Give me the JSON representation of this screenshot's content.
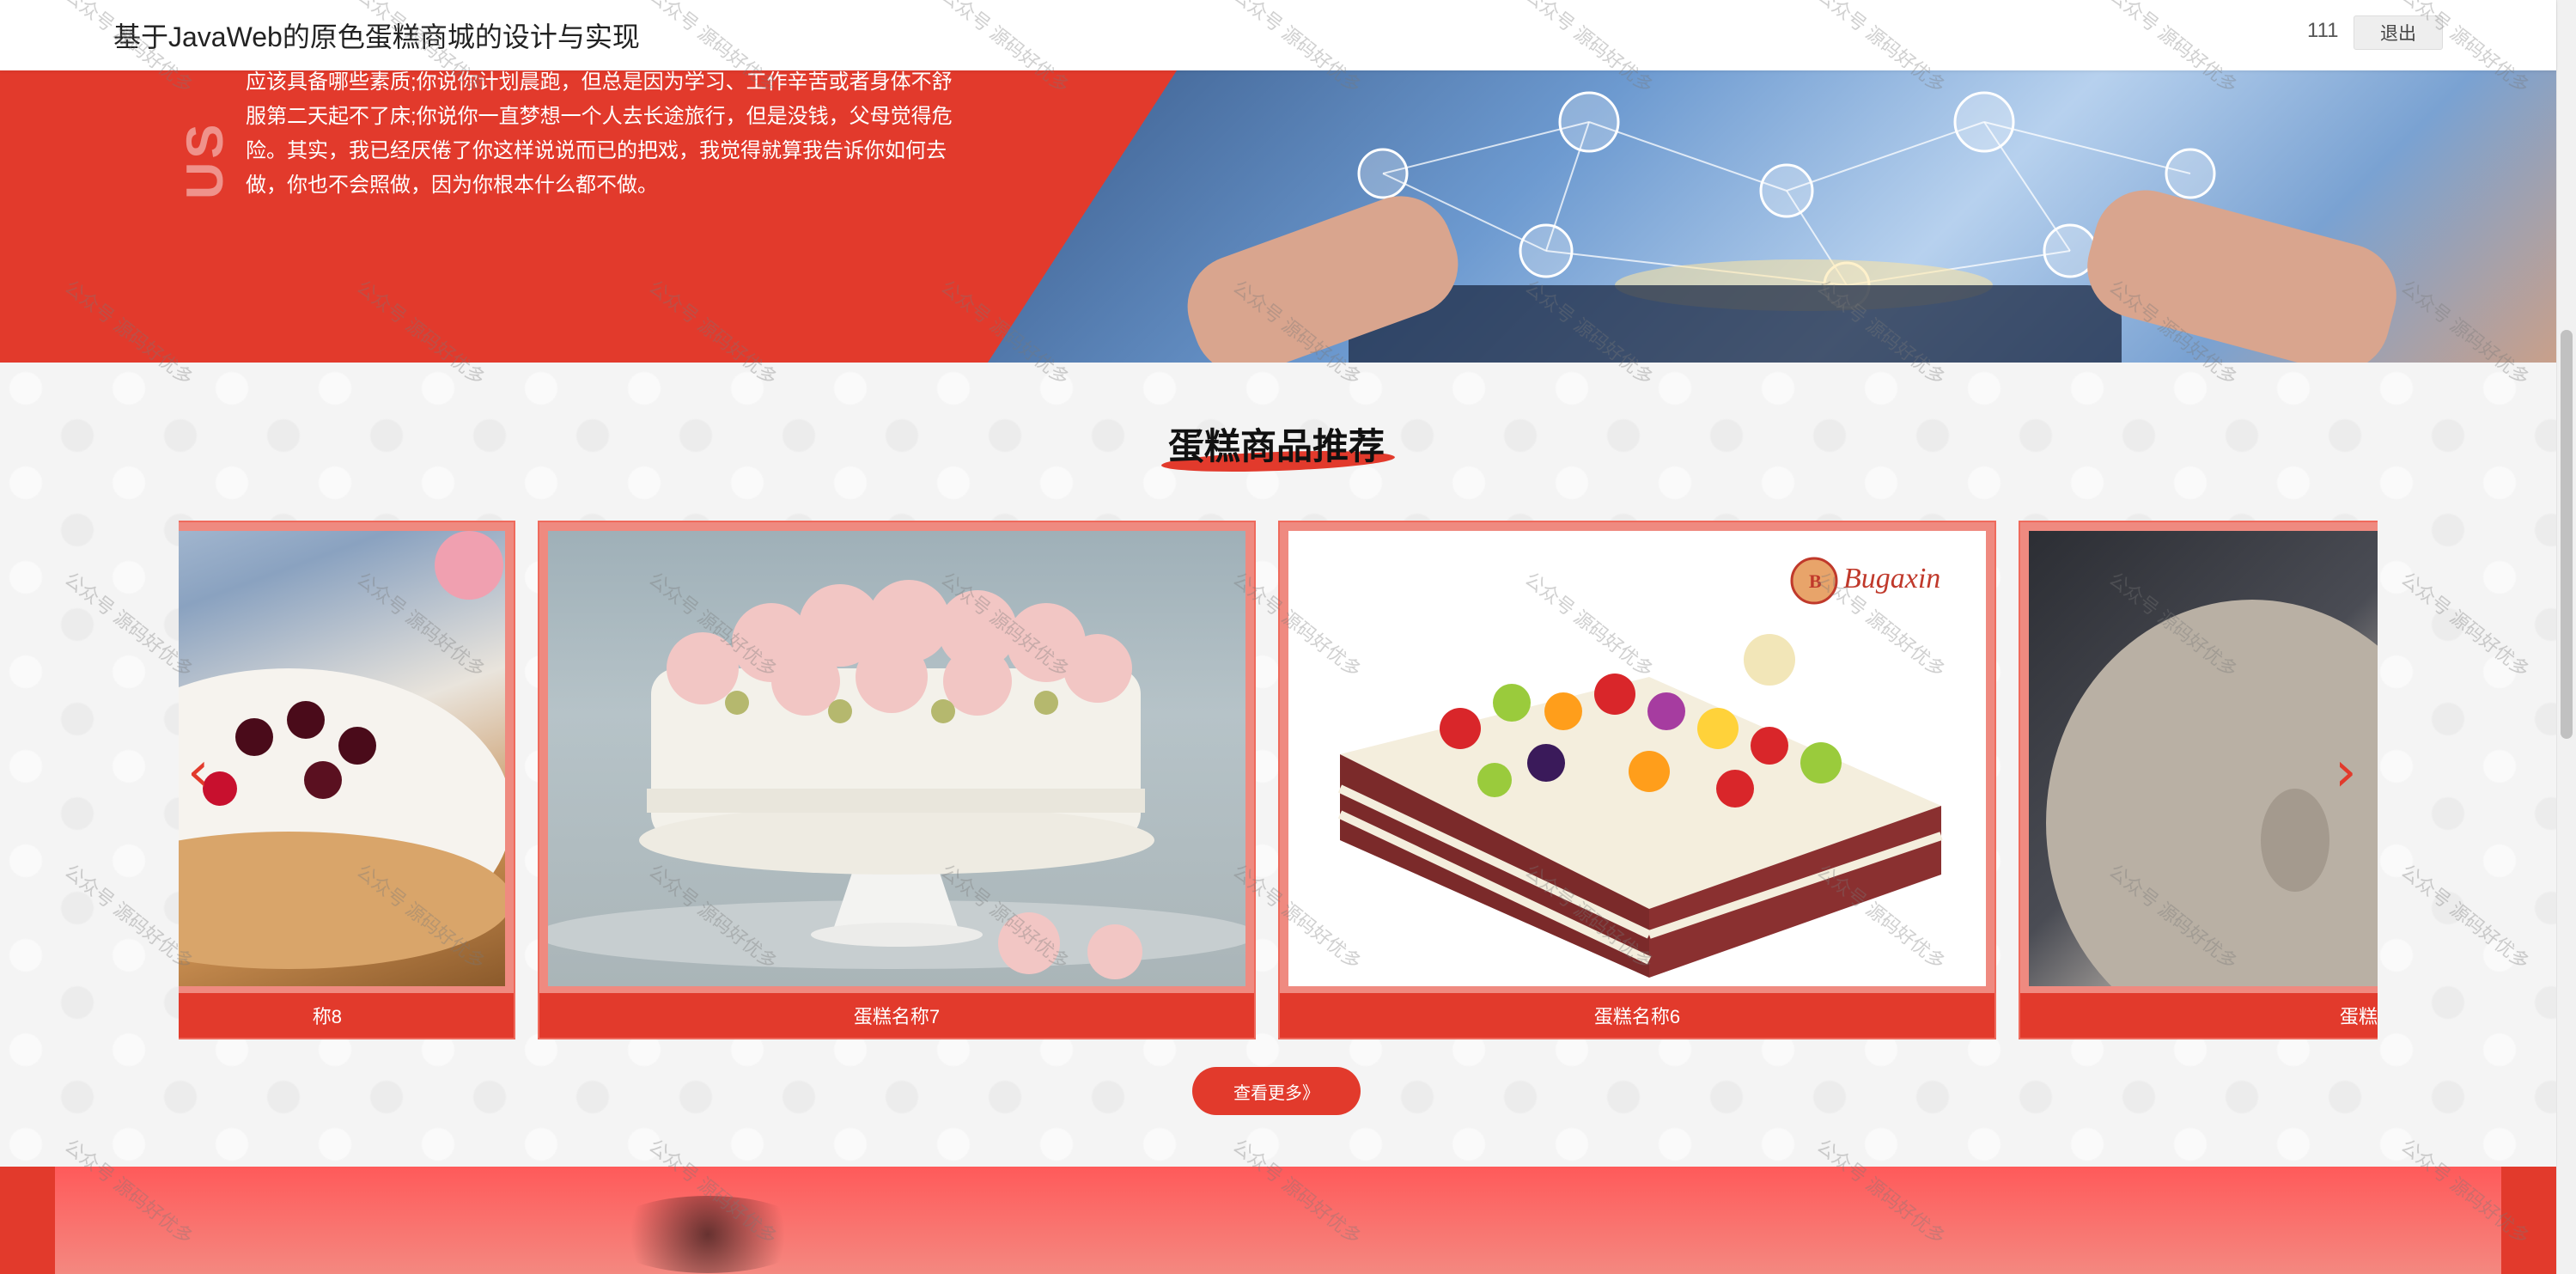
{
  "header": {
    "site_title": "基于JavaWeb的原色蛋糕商城的设计与实现",
    "username": "111",
    "logout_label": "退出"
  },
  "about": {
    "vertical_text": "US",
    "lines": [
      "应该具备哪些素质;你说你计划晨跑，但总是因为学习、工作辛苦或者身体不舒",
      "服第二天起不了床;你说你一直梦想一个人去长途旅行，但是没钱，父母觉得危",
      "险。其实，我已经厌倦了你这样说说而已的把戏，我觉得就算我告诉你如何去",
      "做，你也不会照做，因为你根本什么都不做。"
    ]
  },
  "recommend": {
    "title": "蛋糕商品推荐",
    "items": [
      {
        "caption": "称8",
        "image": "cherry-cake"
      },
      {
        "caption": "蛋糕名称7",
        "image": "rose-cake"
      },
      {
        "caption": "蛋糕名称6",
        "image": "fruit-cake"
      },
      {
        "caption": "蛋糕",
        "image": "gray-photo"
      }
    ],
    "prev_icon": "chevron-left-icon",
    "next_icon": "chevron-right-icon",
    "more_label": "查看更多》"
  },
  "fruit_card_logo": "Bugaxin",
  "watermark_text": "公众号 源码好优多",
  "colors": {
    "primary": "#e23a2c",
    "card_border": "#ef6a5c",
    "banner_pink": "#f48880"
  }
}
